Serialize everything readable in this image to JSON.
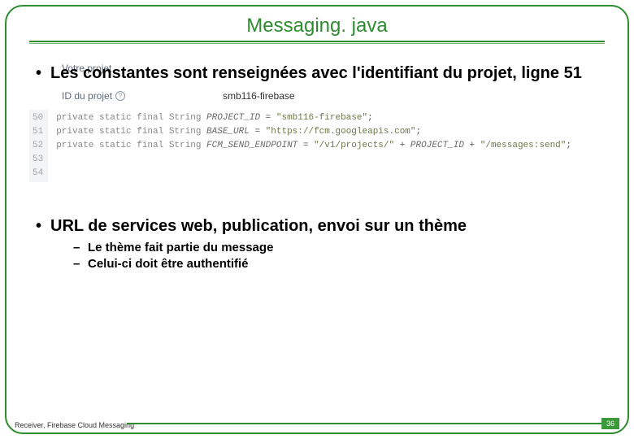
{
  "title": "Messaging. java",
  "bullet1": "Les constantes sont renseignées avec l'identifiant du projet, ligne 51",
  "firebase_panel": {
    "projectname_label": "Votre projet",
    "id_label": "ID du projet",
    "help_glyph": "?",
    "id_value": "smb116-firebase"
  },
  "code": {
    "line_numbers": [
      "50",
      "51",
      "52",
      "53",
      "54"
    ],
    "lines": {
      "l50": "",
      "l51_kw": "private static final ",
      "l51_type": "String ",
      "l51_name": "PROJECT_ID",
      "l51_eq": " = ",
      "l51_val": "\"smb116-firebase\"",
      "l51_end": ";",
      "l52_kw": "private static final ",
      "l52_type": "String ",
      "l52_name": "BASE_URL",
      "l52_eq": " = ",
      "l52_val": "\"https://fcm.googleapis.com\"",
      "l52_end": ";",
      "l53_kw": "private static final ",
      "l53_type": "String ",
      "l53_name": "FCM_SEND_ENDPOINT",
      "l53_eq": " = ",
      "l53_val1": "\"/v1/projects/\"",
      "l53_plus1": " + ",
      "l53_ref": "PROJECT_ID",
      "l53_plus2": " + ",
      "l53_val2": "\"/messages:send\"",
      "l53_end": ";"
    }
  },
  "bullet2": "URL de services web, publication, envoi sur un thème",
  "sub1": "Le thème fait partie du message",
  "sub2": "Celui-ci doit être authentifié",
  "footer_text": "Receiver, Firebase Cloud Messaging",
  "page_number": "36"
}
